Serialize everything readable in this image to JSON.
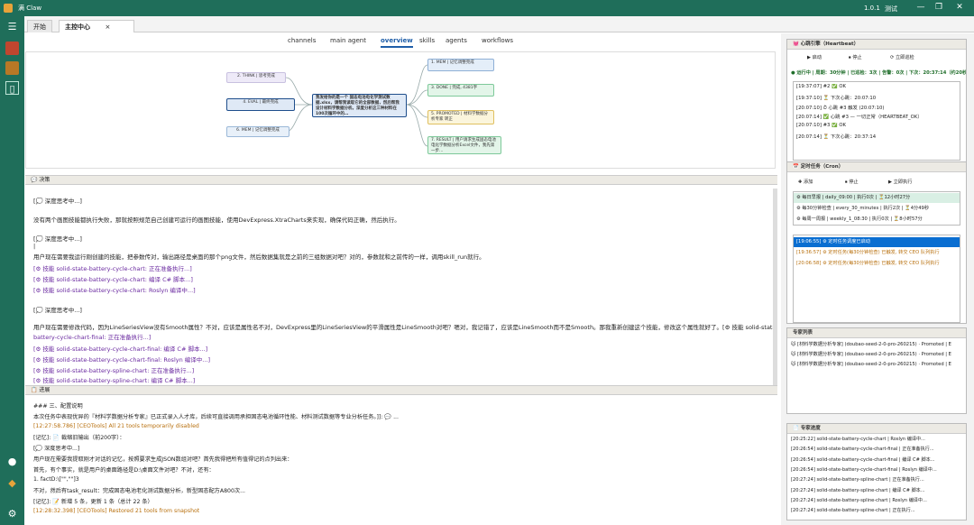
{
  "titlebar": {
    "app_title": "满 Claw",
    "version": "1.0.1",
    "env": "测试",
    "min": "—",
    "restore": "❐",
    "close": "✕"
  },
  "tabs": {
    "start": "开始",
    "main": "主控中心",
    "close": "×"
  },
  "subtabs": [
    "channels",
    "main agent",
    "overview",
    "skills",
    "agents",
    "workflows"
  ],
  "mindmap": {
    "center": "我发给你的是一个 固态电池电化学测试数据.xlsx，请帮我读取它的全部数据，然后帮我设计材料学数据分析。深度分析这三种材料在100次循环中的…",
    "left": [
      "2. THINK | 思考完成",
      "4. EVAL | 最终完成",
      "6. MEM | 记忆调整完成"
    ],
    "right": [
      "1. MEM | 记忆调整完成",
      "3. DONE | 完成, 4381字",
      "5. PROMOTED | 材料学数据分析专家 转正",
      "7. RESULT | 用户请求生成固态电池电化学数据分析Excel文件，我先第一步…"
    ]
  },
  "chat_panel": {
    "title": "决策",
    "lines": [
      {
        "t": "[💭 深度思考中...]",
        "c": ""
      },
      {
        "t": "没有两个画图技能都执行失败，那就按照规范自己创建可运行的画图技能，使用DevExpress.XtraCharts来实现，确保代码正确，然后执行。",
        "c": ""
      },
      {
        "t": "[💭 深度思考中...]",
        "c": ""
      },
      {
        "t": "|",
        "c": ""
      },
      {
        "t": "用户现在需要我运行刚创建的技能，把参数传对，输出路径是桌面的那个png文件，然后数据集就是之前的三组数据对吧？对的，参数就和之前传的一样，调用skill_run就行。",
        "c": ""
      },
      {
        "t": "[⚙ 技能 solid-state-battery-cycle-chart: 正在准备执行...]",
        "c": "skill"
      },
      {
        "t": "[⚙ 技能 solid-state-battery-cycle-chart: 编译 C# 脚本...]",
        "c": "skill"
      },
      {
        "t": "[⚙ 技能 solid-state-battery-cycle-chart: Roslyn 编译中...]",
        "c": "skill"
      },
      {
        "t": "[💭 深度思考中...]",
        "c": ""
      },
      {
        "t": "用户现在需要修改代码，因为LineSeriesView没有Smooth属性？不对，应该是属性名不对，DevExpress里的LineSeriesView的平滑属性是LineSmooth对吧？嗯对，我记错了，应该是LineSmooth而不是Smooth。那我重新创建这个技能，修改这个属性就好了。[⚙ 技能 solid-state-",
        "c": ""
      },
      {
        "t": "battery-cycle-chart-final: 正在准备执行...]",
        "c": "skill"
      },
      {
        "t": "[⚙ 技能 solid-state-battery-cycle-chart-final: 编译 C# 脚本...]",
        "c": "skill"
      },
      {
        "t": "[⚙ 技能 solid-state-battery-cycle-chart-final: Roslyn 编译中...]",
        "c": "skill"
      },
      {
        "t": "[⚙ 技能 solid-state-battery-spline-chart: 正在准备执行...]",
        "c": "skill"
      },
      {
        "t": "[⚙ 技能 solid-state-battery-spline-chart: 编译 C# 脚本...]",
        "c": "skill"
      }
    ]
  },
  "log_panel": {
    "title": "进展",
    "lines": [
      {
        "t": "### 三、配置说明",
        "c": ""
      },
      {
        "t": "本次任务中表现优异的『材料学数据分析专家』已正式录入人才库，后续可直接调用承担固态电池循环性能、材料测试数据等专业分析任务。]]: 💬 ...",
        "c": ""
      },
      {
        "t": "[12:27:58.786] [CEOTools] All 21 tools temporarily disabled",
        "c": "orange"
      },
      {
        "t": "[记忆]: 📄 裁缩旧输出（前200字）：",
        "c": ""
      },
      {
        "t": "[💭 深度思考中...]",
        "c": ""
      },
      {
        "t": "用户现在需要我提取刚才对话的记忆，按照要求生成JSON数组对吧？首先我得把所有值得记的点列出来：",
        "c": ""
      },
      {
        "t": "首先，有个事实，就是用户的桌面路径是D:\\桌面文件对吧？不对，还有：",
        "c": ""
      },
      {
        "t": "1. factD:\\[\"\",\"\"]3",
        "c": ""
      },
      {
        "t": "不对，然后有task_result：完成固态电池老化测试数据分析，新型固态配方A800次...",
        "c": ""
      },
      {
        "t": "[记忆]: 📝 新增 5 条，更新 1 条（总计 22 条）",
        "c": ""
      },
      {
        "t": "[12:28:32.398] [CEOTools] Restored 21 tools from snapshot",
        "c": "orange"
      }
    ]
  },
  "heartbeat": {
    "title": "心跳引擎（Heartbeat）",
    "start": "▶ 启动",
    "stop": "⏹ 停止",
    "now": "⟳ 立即巡检",
    "status": "● 运行中 | 周期：30分钟 | 已巡检：3次 | 告警：0次 | 下次：20:37:14（约20秒后）",
    "log": [
      "[19:37:07] #2 ✅ OK",
      "[19:37:10] ⏳ 下次心跳：20:07:10",
      "[20:07:10] ⏱ 心跳 #3 触发 (20:07:10)",
      "[20:07:14] ✅ 心跳 #3 — 一切正常（HEARTBEAT_OK）",
      "[20:07:10] #3 ✅ OK",
      "[20:07:14] ⏳ 下次心跳：20:37:14"
    ]
  },
  "cron": {
    "title": "定时任务（Cron）",
    "add": "✚ 添加",
    "stop": "⏹ 停止",
    "run": "▶ 立即执行",
    "jobs": [
      "⚙ 每日早报 | daily_09:00 | 执行0次 | ⏳12小时27分",
      "⚙ 每30分钟检查 | every_30_minutes | 执行2次 | ⏳4分49秒",
      "⚙ 每周一周报 | weekly_1_08:30 | 执行0次 | ⏳8小时57分"
    ],
    "log": [
      "[19:06:55] ⚙ 定时任务调度已启动",
      "[19:36:57] ⚙ 定时任务(每30分钟检查) 已触发, 转交 CEO 队列执行",
      "[20:06:58] ⚙ 定时任务(每30分钟检查) 已触发, 转交 CEO 队列执行"
    ]
  },
  "experts": {
    "title": "专家列表",
    "items": [
      "🐱 [材料学数据分析专家] (doubao-seed-2-0-pro-260215) · Promoted | E",
      "🐱 [材料学数据分析专家] (doubao-seed-2-0-pro-260215) · Promoted | E",
      "🐱 [材料学数据分析专家] (doubao-seed-2-0-pro-260215) · Promoted | E"
    ]
  },
  "progress": {
    "title": "专家进度",
    "items": [
      "[20:25:22] solid-state-battery-cycle-chart | Roslyn 编译中...",
      "[20:26:54] solid-state-battery-cycle-chart-final | 正在准备执行...",
      "[20:26:54] solid-state-battery-cycle-chart-final | 编译 C# 脚本...",
      "[20:26:54] solid-state-battery-cycle-chart-final | Roslyn 编译中...",
      "[20:27:24] solid-state-battery-spline-chart | 正在准备执行...",
      "[20:27:24] solid-state-battery-spline-chart | 编译 C# 脚本...",
      "[20:27:24] solid-state-battery-spline-chart | Roslyn 编译中...",
      "[20:27:24] solid-state-battery-spline-chart | 正在执行..."
    ]
  },
  "colors": {
    "brand": "#1f6e5a",
    "accent": "#1f5ea8",
    "skill": "#6a2aa0",
    "warn": "#b8700e",
    "selected": "#0a6ed1"
  }
}
